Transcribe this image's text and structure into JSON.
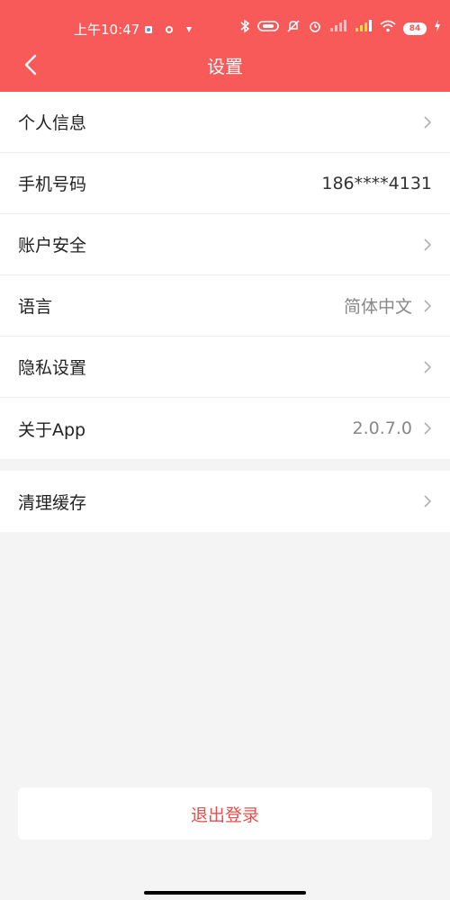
{
  "status_bar": {
    "time": "上午10:47",
    "battery": "84"
  },
  "header": {
    "title": "设置"
  },
  "settings_group_1": [
    {
      "label": "个人信息",
      "value": "",
      "has_chevron": true
    },
    {
      "label": "手机号码",
      "value": "186****4131",
      "has_chevron": false
    },
    {
      "label": "账户安全",
      "value": "",
      "has_chevron": true
    },
    {
      "label": "语言",
      "value": "简体中文",
      "has_chevron": true
    },
    {
      "label": "隐私设置",
      "value": "",
      "has_chevron": true
    },
    {
      "label": "关于App",
      "value": "2.0.7.0",
      "has_chevron": true
    }
  ],
  "settings_group_2": [
    {
      "label": "清理缓存",
      "value": "",
      "has_chevron": true
    }
  ],
  "logout": {
    "label": "退出登录"
  },
  "colors": {
    "header_bg": "#f75a58",
    "logout_text": "#e8504e",
    "page_bg": "#f4f4f4"
  }
}
